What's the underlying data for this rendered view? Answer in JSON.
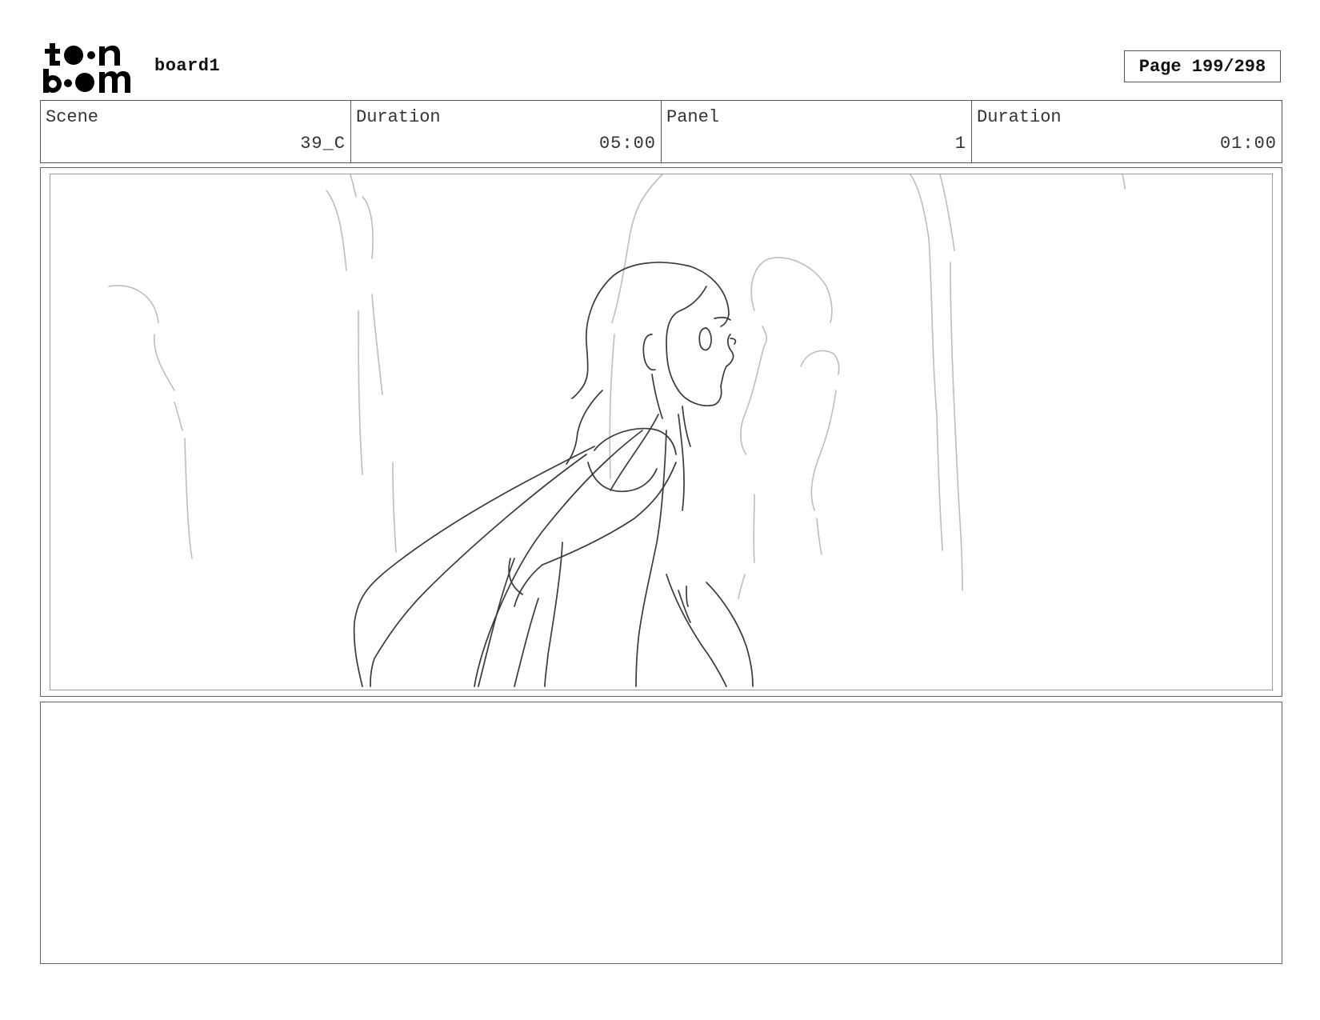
{
  "header": {
    "project_name": "board1",
    "page_label": "Page 199/298"
  },
  "info": {
    "scene_label": "Scene",
    "scene_value": "39_C",
    "scene_duration_label": "Duration",
    "scene_duration_value": "05:00",
    "panel_label": "Panel",
    "panel_value": "1",
    "panel_duration_label": "Duration",
    "panel_duration_value": "01:00"
  },
  "notes": {
    "text": ""
  },
  "icons": {
    "logo": "toon-boom-logo-icon"
  }
}
